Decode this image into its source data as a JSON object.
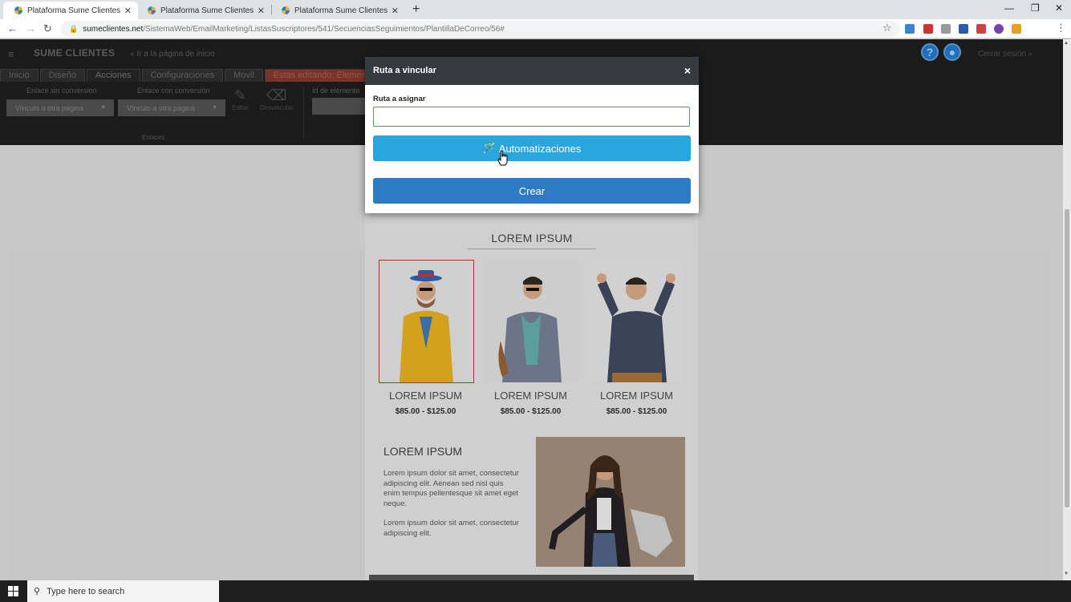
{
  "browser": {
    "tabs": [
      {
        "label": "Plataforma Sume Clientes",
        "active": true
      },
      {
        "label": "Plataforma Sume Clientes",
        "active": false
      },
      {
        "label": "Plataforma Sume Clientes",
        "active": false
      }
    ],
    "url_host": "sumeclientes.net",
    "url_path": "/SistemaWeb/EmailMarketing/ListasSuscriptores/541/SecuenciasSeguimientos/PlantillaDeCorreo/56#"
  },
  "app": {
    "logo": "SUME CLIENTES",
    "back_link": "« Ir a la página de inicio",
    "logout": "Cerrar sesión »",
    "tabs": [
      "Inicio",
      "Diseño",
      "Acciones",
      "Configuraciones",
      "Movil",
      "Estás editando: Elemento D"
    ],
    "toolbar": {
      "link_no_conversion_label": "Enlace sin conversión",
      "link_no_conversion_value": "Vínculo a otra página",
      "link_conversion_label": "Enlace con conversión",
      "link_conversion_value": "Vínculo a otra página",
      "edit_label": "Editar",
      "unlink_label": "Desvincular",
      "element_id_label": "Id de elemento",
      "group_label": "Enlaces"
    }
  },
  "template": {
    "section_title": "LOREM IPSUM",
    "products": [
      {
        "name": "LOREM IPSUM",
        "price": "$85.00 - $125.00"
      },
      {
        "name": "LOREM IPSUM",
        "price": "$85.00 - $125.00"
      },
      {
        "name": "LOREM IPSUM",
        "price": "$85.00 - $125.00"
      }
    ],
    "article": {
      "title": "LOREM IPSUM",
      "paragraph1": "Lorem ipsum dolor sit amet, consectetur adipiscing elit. Aenean sed nisl quis enim tempus pellentesque sit amet eget neque.",
      "paragraph2": "Lorem ipsum dolor sit amet, consectetur adipiscing elit."
    }
  },
  "modal": {
    "title": "Ruta a vincular",
    "close": "×",
    "field_label": "Ruta a asignar",
    "field_value": "",
    "automations_button": "Automatizaciones",
    "create_button": "Crear"
  },
  "taskbar": {
    "search_placeholder": "Type here to search"
  },
  "colors": {
    "modal_header": "#343a40",
    "automations_button": "#29a6de",
    "create_button": "#2d7bc3",
    "editing_tab": "#7a3427"
  }
}
